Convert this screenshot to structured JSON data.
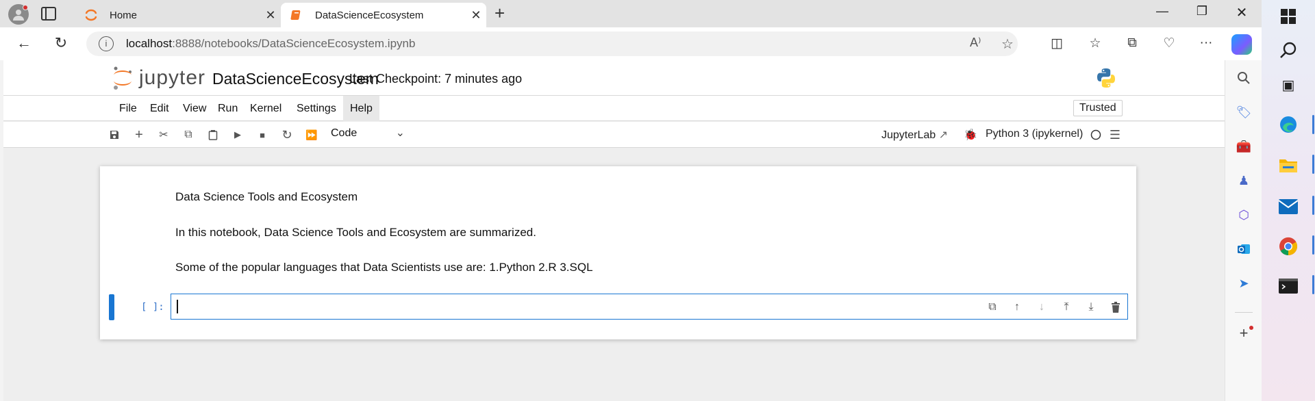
{
  "browser": {
    "tabs": [
      {
        "title": "Home",
        "active": false
      },
      {
        "title": "DataScienceEcosystem",
        "active": true
      }
    ],
    "url_host": "localhost",
    "url_path": ":8888/notebooks/DataScienceEcosystem.ipynb",
    "window_controls": [
      "minimize",
      "restore",
      "close"
    ]
  },
  "jupyter": {
    "logo_text": "jupyter",
    "notebook_title": "DataScienceEcosystem",
    "checkpoint": "Last Checkpoint: 7 minutes ago",
    "menu": [
      "File",
      "Edit",
      "View",
      "Run",
      "Kernel",
      "Settings",
      "Help"
    ],
    "active_menu": "Help",
    "trusted": "Trusted",
    "cell_type": "Code",
    "jupyterlab_link": "JupyterLab",
    "kernel": "Python 3 (ipykernel)"
  },
  "notebook": {
    "markdown": [
      "Data Science Tools and Ecosystem",
      "In this notebook, Data Science Tools and Ecosystem are summarized.",
      "Some of the popular languages that Data Scientists use are: 1.Python 2.R 3.SQL"
    ],
    "code_prompt": "[ ]:",
    "code_value": ""
  },
  "colors": {
    "accent": "#1976d2",
    "jupyter_orange": "#f37726",
    "tab_bar": "#e3e3e3"
  }
}
